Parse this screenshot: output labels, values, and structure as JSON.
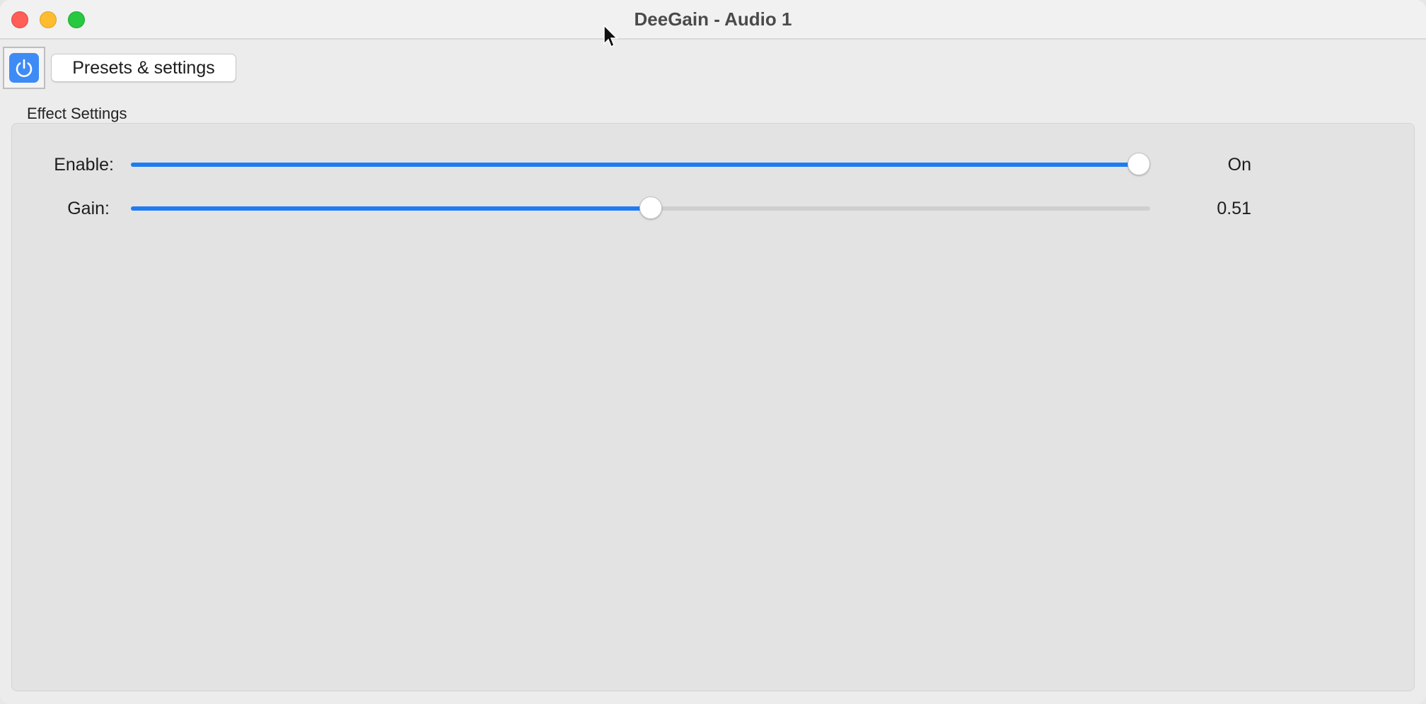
{
  "window": {
    "title": "DeeGain - Audio 1"
  },
  "toolbar": {
    "presets_label": "Presets & settings",
    "power_icon": "power-icon"
  },
  "effect_settings": {
    "group_label": "Effect Settings",
    "params": [
      {
        "label": "Enable:",
        "value_text": "On",
        "fraction": 1.0
      },
      {
        "label": "Gain:",
        "value_text": "0.51",
        "fraction": 0.51
      }
    ]
  },
  "colors": {
    "accent": "#1e7cf2",
    "power_button": "#3e8bf5"
  }
}
